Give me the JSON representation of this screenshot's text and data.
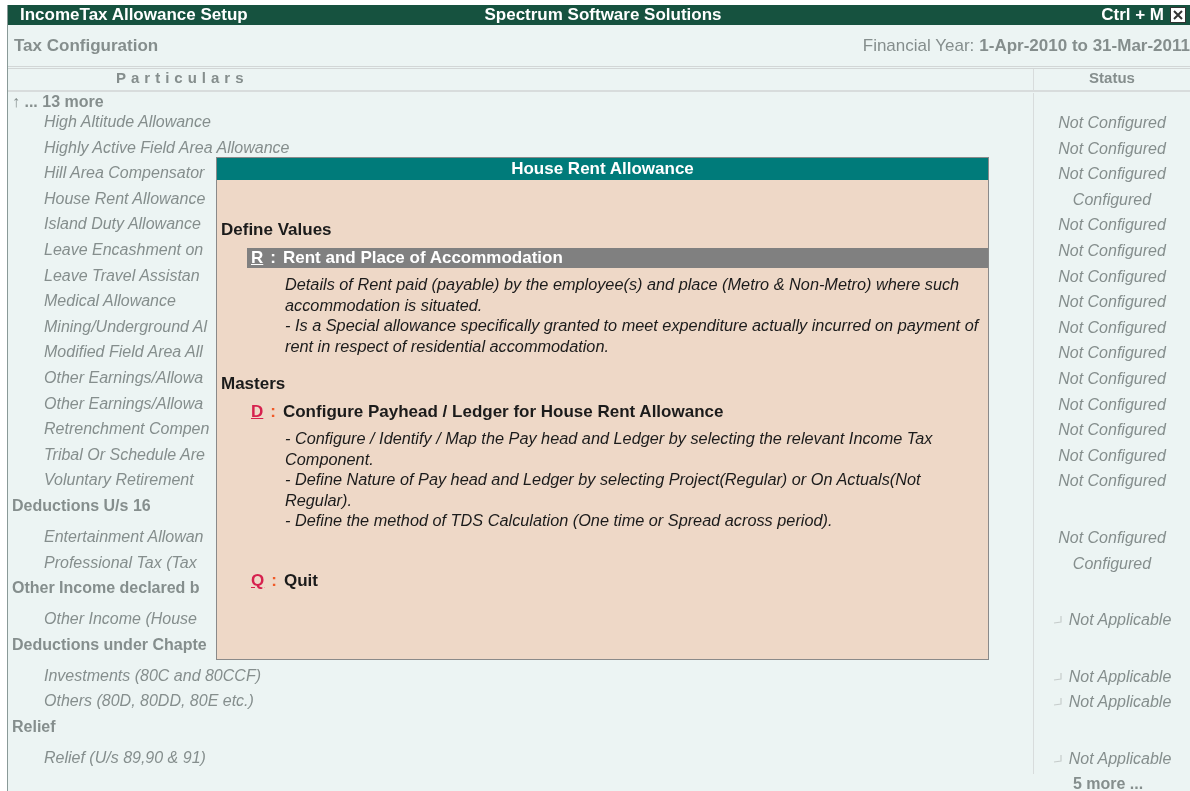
{
  "window": {
    "title": "IncomeTax Allowance Setup",
    "company": "Spectrum Software Solutions",
    "shortcut": "Ctrl + M"
  },
  "header": {
    "title": "Tax Configuration",
    "period_label": "Financial Year:",
    "period": "1-Apr-2010 to 31-Mar-2011"
  },
  "table": {
    "columns": [
      "Particulars",
      "Status"
    ],
    "rows": [
      {
        "kind": "more",
        "label": "↑ ... 13 more"
      },
      {
        "kind": "item",
        "label": "High Altitude Allowance",
        "status": {
          "text": "Not Configured",
          "return_mark": false
        }
      },
      {
        "kind": "item",
        "label": "Highly Active Field Area Allowance",
        "status": {
          "text": "Not Configured",
          "return_mark": false
        }
      },
      {
        "kind": "item",
        "label": "Hill Area Compensator",
        "status": {
          "text": "Not Configured",
          "return_mark": false
        }
      },
      {
        "kind": "item",
        "label": "House Rent Allowance",
        "status": {
          "text": "Configured",
          "return_mark": false
        }
      },
      {
        "kind": "item",
        "label": "Island Duty Allowance",
        "status": {
          "text": "Not Configured",
          "return_mark": false
        }
      },
      {
        "kind": "item",
        "label": "Leave Encashment on",
        "status": {
          "text": "Not Configured",
          "return_mark": false
        }
      },
      {
        "kind": "item",
        "label": "Leave Travel Assistan",
        "status": {
          "text": "Not Configured",
          "return_mark": false
        }
      },
      {
        "kind": "item",
        "label": "Medical Allowance",
        "status": {
          "text": "Not Configured",
          "return_mark": false
        }
      },
      {
        "kind": "item",
        "label": "Mining/Underground Al",
        "status": {
          "text": "Not Configured",
          "return_mark": false
        }
      },
      {
        "kind": "item",
        "label": "Modified Field Area All",
        "status": {
          "text": "Not Configured",
          "return_mark": false
        }
      },
      {
        "kind": "item",
        "label": "Other Earnings/Allowa",
        "status": {
          "text": "Not Configured",
          "return_mark": false
        }
      },
      {
        "kind": "item",
        "label": "Other Earnings/Allowa",
        "status": {
          "text": "Not Configured",
          "return_mark": false
        }
      },
      {
        "kind": "item",
        "label": "Retrenchment Compen",
        "status": {
          "text": "Not Configured",
          "return_mark": false
        }
      },
      {
        "kind": "item",
        "label": "Tribal Or Schedule Are",
        "status": {
          "text": "Not Configured",
          "return_mark": false
        }
      },
      {
        "kind": "item",
        "label": "Voluntary Retirement",
        "status": {
          "text": "Not Configured",
          "return_mark": false
        }
      },
      {
        "kind": "group",
        "label": "Deductions U/s 16"
      },
      {
        "kind": "item",
        "label": "Entertainment Allowan",
        "status": {
          "text": "Not Configured",
          "return_mark": false
        }
      },
      {
        "kind": "item",
        "label": "Professional Tax (Tax",
        "status": {
          "text": "Configured",
          "return_mark": false
        }
      },
      {
        "kind": "group",
        "label": "Other Income declared b"
      },
      {
        "kind": "item",
        "label": "Other Income (House",
        "status": {
          "text": "Not Applicable",
          "return_mark": true
        }
      },
      {
        "kind": "group",
        "label": "Deductions under Chapte"
      },
      {
        "kind": "item",
        "label": "Investments (80C and 80CCF)",
        "status": {
          "text": "Not Applicable",
          "return_mark": true
        }
      },
      {
        "kind": "item",
        "label": "Others (80D, 80DD, 80E etc.)",
        "status": {
          "text": "Not Applicable",
          "return_mark": true
        }
      },
      {
        "kind": "group",
        "label": "Relief"
      },
      {
        "kind": "item",
        "label": "Relief (U/s 89,90 & 91)",
        "status": {
          "text": "Not Applicable",
          "return_mark": true
        }
      }
    ],
    "more_below": "5 more ..."
  },
  "dialog": {
    "title": "House Rent Allowance",
    "sections": [
      {
        "heading": "Define Values",
        "items": [
          {
            "key": "R",
            "separator": ":",
            "label": "Rent and Place of Accommodation",
            "selected": true,
            "description": [
              "Details of Rent paid (payable) by the employee(s) and place (Metro & Non-Metro) where such accommodation is situated.",
              "- Is a Special allowance specifically granted to meet expenditure actually incurred on payment of rent in respect of residential accommodation."
            ]
          }
        ]
      },
      {
        "heading": "Masters",
        "items": [
          {
            "key": "D",
            "separator": ":",
            "label": "Configure Payhead / Ledger for House Rent Allowance",
            "selected": false,
            "description": [
              "- Configure / Identify / Map the Pay head and Ledger by selecting the relevant Income Tax Component.",
              "- Define Nature of Pay head and Ledger by selecting Project(Regular) or On Actuals(Not Regular).",
              "- Define the method of TDS Calculation (One time or Spread across period)."
            ]
          },
          {
            "key": "Q",
            "separator": ":",
            "label": "Quit",
            "selected": false
          }
        ]
      }
    ]
  }
}
